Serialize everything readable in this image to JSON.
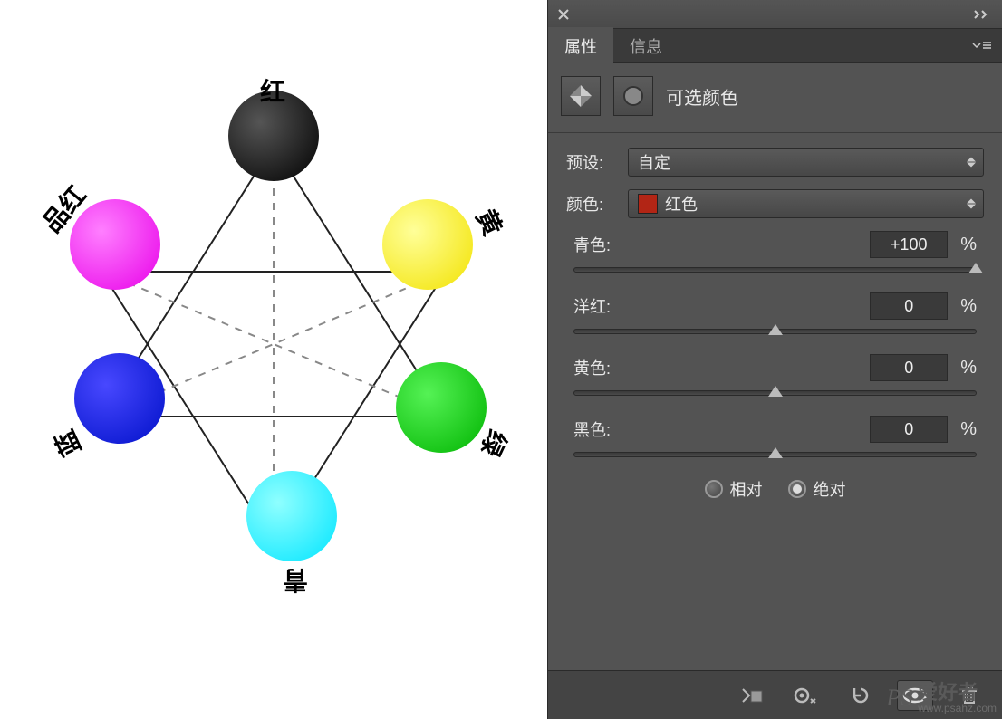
{
  "diagram": {
    "labels": {
      "top": "红",
      "topRight": "黄",
      "bottomRight": "绿",
      "bottom": "青",
      "bottomLeft": "蓝",
      "topLeft": "品红"
    }
  },
  "panel": {
    "tabs": {
      "properties": "属性",
      "info": "信息"
    },
    "adjustment": {
      "name": "可选颜色"
    },
    "preset": {
      "label": "预设:",
      "value": "自定"
    },
    "colors": {
      "label": "颜色:",
      "value": "红色",
      "swatch": "#b22515"
    },
    "sliders": {
      "cyan": {
        "label": "青色:",
        "value": "+100",
        "pos": 100
      },
      "magenta": {
        "label": "洋红:",
        "value": "0",
        "pos": 50
      },
      "yellow": {
        "label": "黄色:",
        "value": "0",
        "pos": 50
      },
      "black": {
        "label": "黑色:",
        "value": "0",
        "pos": 50
      }
    },
    "method": {
      "relative": "相对",
      "absolute": "绝对",
      "selected": "absolute"
    },
    "unit": "%"
  },
  "watermark": {
    "ps": "PS",
    "cn": "爱好者",
    "url": "www.psahz.com"
  }
}
